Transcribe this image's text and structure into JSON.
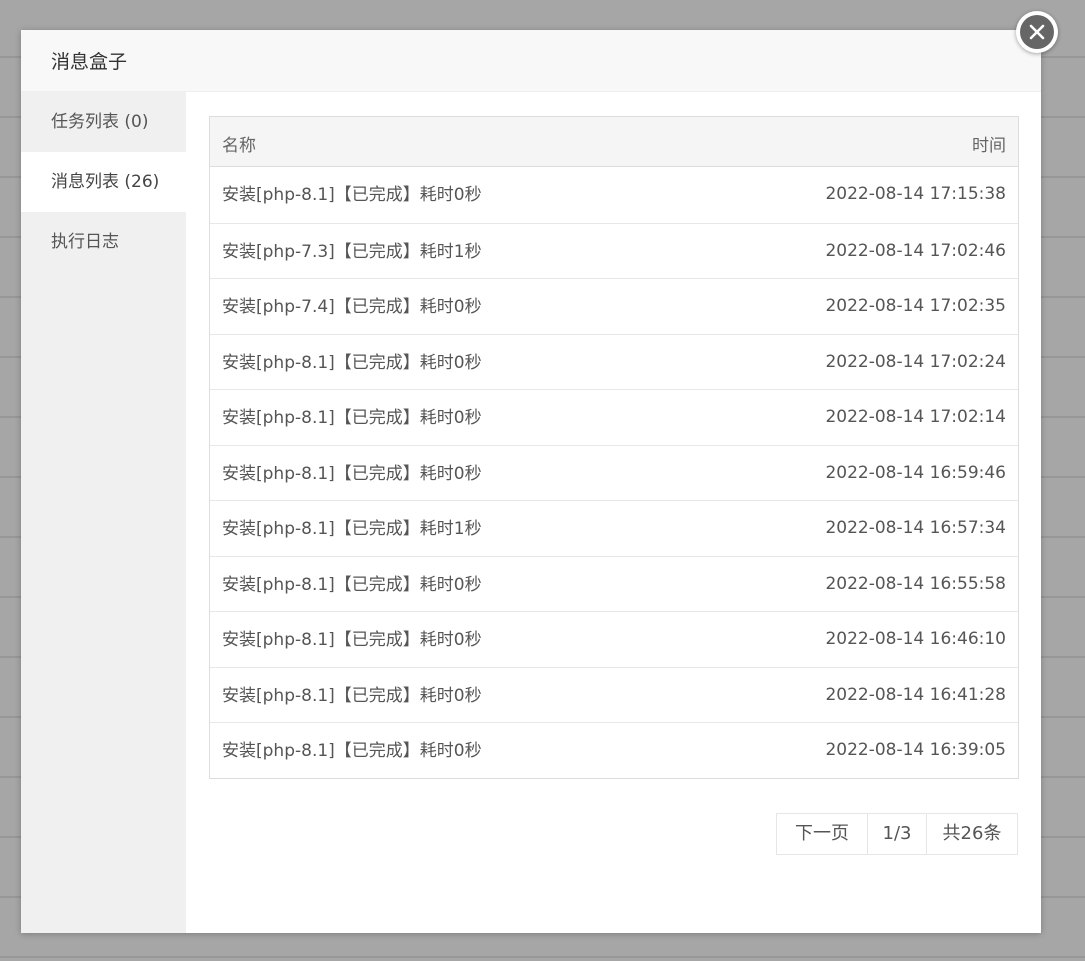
{
  "modal": {
    "title": "消息盒子"
  },
  "sidebar": {
    "items": [
      {
        "label": "任务列表 (0)"
      },
      {
        "label": "消息列表 (26)"
      },
      {
        "label": "执行日志"
      }
    ],
    "active_index": 1
  },
  "table": {
    "headers": {
      "name": "名称",
      "time": "时间"
    },
    "rows": [
      {
        "name": "安装[php-8.1]【已完成】耗时0秒",
        "time": "2022-08-14 17:15:38"
      },
      {
        "name": "安装[php-7.3]【已完成】耗时1秒",
        "time": "2022-08-14 17:02:46"
      },
      {
        "name": "安装[php-7.4]【已完成】耗时0秒",
        "time": "2022-08-14 17:02:35"
      },
      {
        "name": "安装[php-8.1]【已完成】耗时0秒",
        "time": "2022-08-14 17:02:24"
      },
      {
        "name": "安装[php-8.1]【已完成】耗时0秒",
        "time": "2022-08-14 17:02:14"
      },
      {
        "name": "安装[php-8.1]【已完成】耗时0秒",
        "time": "2022-08-14 16:59:46"
      },
      {
        "name": "安装[php-8.1]【已完成】耗时1秒",
        "time": "2022-08-14 16:57:34"
      },
      {
        "name": "安装[php-8.1]【已完成】耗时0秒",
        "time": "2022-08-14 16:55:58"
      },
      {
        "name": "安装[php-8.1]【已完成】耗时0秒",
        "time": "2022-08-14 16:46:10"
      },
      {
        "name": "安装[php-8.1]【已完成】耗时0秒",
        "time": "2022-08-14 16:41:28"
      },
      {
        "name": "安装[php-8.1]【已完成】耗时0秒",
        "time": "2022-08-14 16:39:05"
      }
    ]
  },
  "pagination": {
    "next_label": "下一页",
    "page": "1/3",
    "total": "共26条"
  },
  "icons": {
    "close": "close-icon"
  },
  "colors": {
    "overlay": "#a6a6a6",
    "header_bg": "#f8f8f8",
    "sidebar_bg": "#f0f0f0",
    "close_bg": "#666666"
  }
}
